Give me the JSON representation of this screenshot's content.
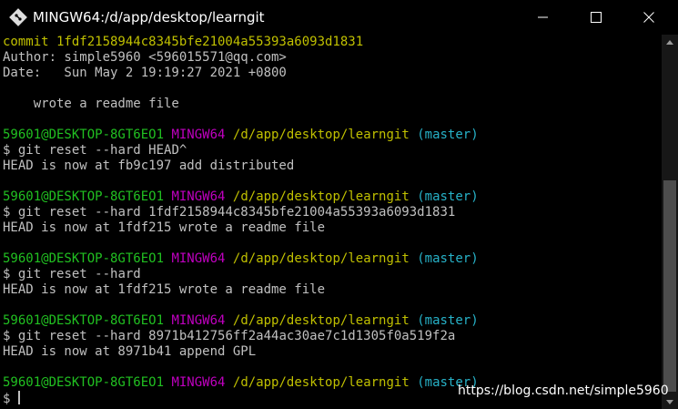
{
  "window": {
    "title": "MINGW64:/d/app/desktop/learngit",
    "app_icon": "git-diamond-icon",
    "buttons": {
      "minimize_icon": "minimize-icon",
      "maximize_icon": "maximize-icon",
      "close_icon": "close-icon"
    }
  },
  "colors": {
    "commit_yellow": "#c0c000",
    "prompt_green": "#21c021",
    "prompt_magenta": "#c000c0",
    "branch_cyan": "#27b2c8",
    "text_gray": "#c0c0c0",
    "background": "#000000"
  },
  "prompt": {
    "user_host": "59601@DESKTOP-8GT6EO1",
    "shell": "MINGW64",
    "path": "/d/app/desktop/learngit",
    "branch": "(master)",
    "symbol": "$"
  },
  "log": {
    "commit": "commit 1fdf2158944c8345bfe21004a55393a6093d1831",
    "author": "Author: simple5960 <596015571@qq.com>",
    "date": "Date:   Sun May 2 19:19:27 2021 +0800",
    "message": "    wrote a readme file"
  },
  "commands": [
    {
      "cmd": "git reset --hard HEAD^",
      "output": "HEAD is now at fb9c197 add distributed"
    },
    {
      "cmd": "git reset --hard 1fdf2158944c8345bfe21004a55393a6093d1831",
      "output": "HEAD is now at 1fdf215 wrote a readme file"
    },
    {
      "cmd": "git reset --hard",
      "output": "HEAD is now at 1fdf215 wrote a readme file"
    },
    {
      "cmd": "git reset --hard 8971b412756ff2a44ac30ae7c1d1305f0a519f2a",
      "output": "HEAD is now at 8971b41 append GPL"
    }
  ],
  "watermark": "https://blog.csdn.net/simple5960"
}
